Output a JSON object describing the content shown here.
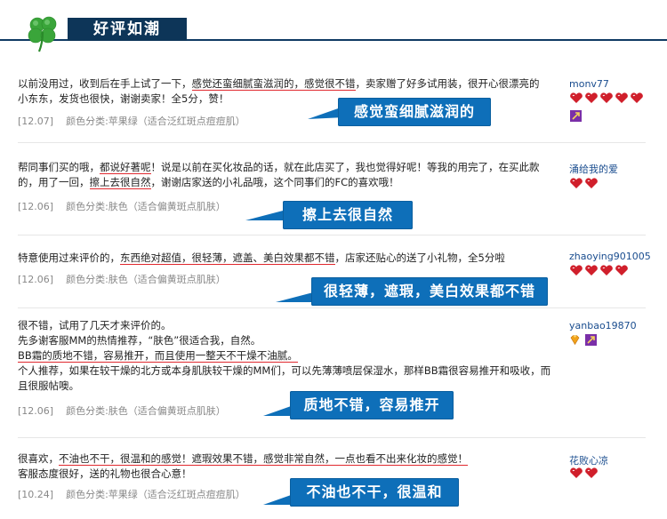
{
  "header": {
    "title": "好评如潮"
  },
  "reviews": [
    {
      "lines": [
        [
          "以前没用过，收到后在手上试了一下，",
          {
            "u": "感觉还蛮细腻蛮滋润的，感觉很不错"
          },
          "，卖家赠了好多试用装，很开心很漂亮的"
        ],
        [
          "小东东，发货也很快，谢谢卖家！全5分，赞！"
        ]
      ],
      "date": "[12.07]",
      "variant": "颜色分类:苹果绿（适合泛红斑点痘痘肌）",
      "user": "monv77",
      "hearts": 5,
      "extra_icon": "vip-purple-icon",
      "bubble": "感觉蛮细腻滋润的"
    },
    {
      "lines": [
        [
          "帮同事们买的哦，",
          {
            "u": "都说好著呢"
          },
          "！说是以前在买化妆品的话，就在此店买了，我也觉得好呢！等我的用完了，在买此款"
        ],
        [
          "的，用了一回，",
          {
            "u": "擦上去很自然"
          },
          "，谢谢店家送的小礼品哦，这个同事们的FC的喜欢哦！"
        ]
      ],
      "date": "[12.06]",
      "variant": "颜色分类:肤色（适合偏黄斑点肌肤）",
      "user": "涌给我的爱",
      "hearts": 2,
      "extra_icon": "",
      "bubble": "擦上去很自然"
    },
    {
      "lines": [
        [
          "特意使用过来评价的，",
          {
            "u": "东西绝对超值，很轻薄，遮盖、美白效果都不错"
          },
          "，店家还贴心的送了小礼物，全5分啦"
        ]
      ],
      "date": "[12.06]",
      "variant": "颜色分类:肤色（适合偏黄斑点肌肤）",
      "user": "zhaoying901005",
      "hearts": 4,
      "extra_icon": "",
      "bubble": "很轻薄，遮瑕，美白效果都不错"
    },
    {
      "lines": [
        [
          "很不错，试用了几天才来评价的。"
        ],
        [
          "先多谢客服MM的热情推荐，“肤色”很适合我，自然。"
        ],
        [
          {
            "u": "BB霜的质地不错，容易推开，而且使用一整天不干燥不油腻。"
          }
        ],
        [
          "个人推荐，如果在较干燥的北方或本身肌肤较干燥的MM们，可以先薄薄喷层保湿水，那样BB霜很容易推开和吸收，而"
        ],
        [
          "且很服帖噢。"
        ]
      ],
      "date": "[12.06]",
      "variant": "颜色分类:肤色（适合偏黄斑点肌肤）",
      "user": "yanbao19870",
      "hearts": 0,
      "extra_icon": "diamond-icon",
      "bubble": "质地不错，容易推开"
    },
    {
      "lines": [
        [
          "很喜欢，",
          {
            "u": "不油也不干，很温和的感觉！遮瑕效果不错，感觉非常自然，一点也看不出来化妆的感觉！"
          }
        ],
        [
          "客服态度很好，送的礼物也很合心意！"
        ]
      ],
      "date": "[10.24]",
      "variant": "颜色分类:苹果绿（适合泛红斑点痘痘肌）",
      "user": "花败心凉",
      "hearts": 2,
      "extra_icon": "",
      "bubble": "不油也不干，很温和"
    }
  ],
  "colors": {
    "header_bg": "#0d3558",
    "bubble_bg": "#0e6fb9",
    "underline": "#e0282e",
    "heart": "#d01f2b",
    "user": "#1a4d8f"
  }
}
